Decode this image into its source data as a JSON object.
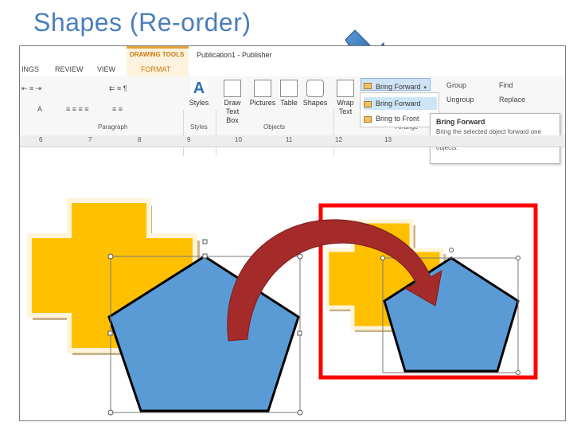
{
  "slide": {
    "title": "Shapes (Re-order)"
  },
  "ribbon": {
    "context_title": "DRAWING TOOLS",
    "app_title": "Publication1 - Publisher",
    "tabs": [
      {
        "label": "INGS"
      },
      {
        "label": "REVIEW"
      },
      {
        "label": "VIEW"
      },
      {
        "label": "FORMAT",
        "active": true
      }
    ],
    "groups": {
      "paragraph": "Paragraph",
      "styles": "Styles",
      "objects": "Objects",
      "arrange": "Arrange"
    },
    "buttons": {
      "styles": "Styles",
      "draw_text_box": "Draw Text Box",
      "pictures": "Pictures",
      "table": "Table",
      "shapes": "Shapes",
      "wrap_text": "Wrap Text",
      "bring_forward": "Bring Forward",
      "group": "Group",
      "ungroup": "Ungroup",
      "find": "Find",
      "replace": "Replace"
    },
    "dropdown": {
      "items": [
        {
          "label": "Bring Forward",
          "highlighted": true
        },
        {
          "label": "Bring to Front",
          "highlighted": false
        }
      ]
    },
    "tooltip": {
      "title": "Bring Forward",
      "body": "Bring the selected object forward one level so that it's hidden behind fewer objects."
    },
    "ruler_numbers": [
      "6",
      "7",
      "8",
      "9",
      "10",
      "11",
      "12",
      "13"
    ]
  },
  "colors": {
    "title": "#4a7ebb",
    "cross_fill": "#ffc000",
    "pentagon_fill": "#5b9bd5",
    "highlight_box": "#ff0000",
    "curved_arrow": "#a52a2a",
    "context_tab_accent": "#e5a23b"
  }
}
